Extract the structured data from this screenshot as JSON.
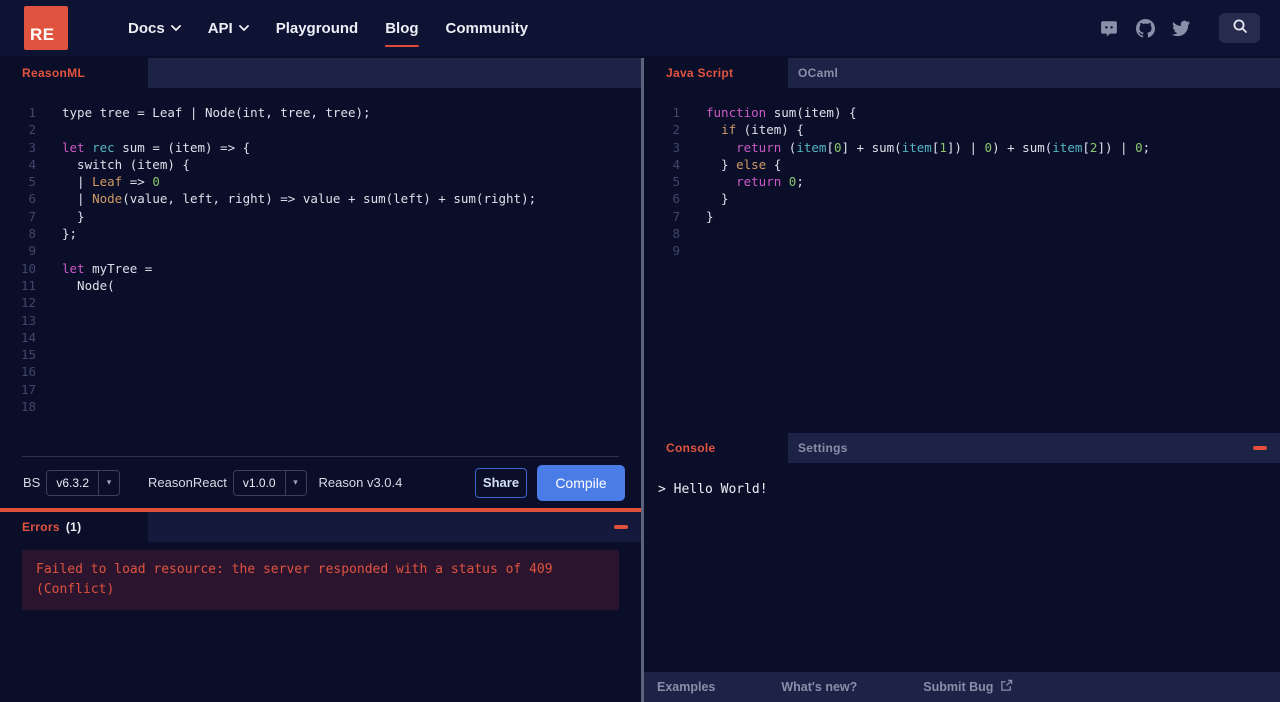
{
  "nav": {
    "logo_text": "RE",
    "links": [
      {
        "label": "Docs",
        "caret": true
      },
      {
        "label": "API",
        "caret": true
      },
      {
        "label": "Playground",
        "caret": false
      },
      {
        "label": "Blog",
        "caret": false,
        "active": true
      },
      {
        "label": "Community",
        "caret": false
      }
    ],
    "icons": [
      "discord-icon",
      "github-icon",
      "twitter-icon",
      "search-icon"
    ]
  },
  "left_editor": {
    "tab": "ReasonML",
    "total_lines": 18,
    "lines": [
      [
        {
          "t": "type tree = Leaf | Node(int, tree, tree);",
          "c": "plain"
        }
      ],
      [],
      [
        {
          "t": "let",
          "c": "kw"
        },
        {
          "t": " ",
          "c": "plain"
        },
        {
          "t": "rec",
          "c": "cyan"
        },
        {
          "t": " sum = (item) => {",
          "c": "plain"
        }
      ],
      [
        {
          "t": "  switch (item) {",
          "c": "plain"
        }
      ],
      [
        {
          "t": "  | ",
          "c": "plain"
        },
        {
          "t": "Leaf",
          "c": "orange"
        },
        {
          "t": " => ",
          "c": "plain"
        },
        {
          "t": "0",
          "c": "green"
        }
      ],
      [
        {
          "t": "  | ",
          "c": "plain"
        },
        {
          "t": "Node",
          "c": "orange"
        },
        {
          "t": "(value, left, right) => value + sum(left) + sum(right);",
          "c": "plain"
        }
      ],
      [
        {
          "t": "  }",
          "c": "plain"
        }
      ],
      [
        {
          "t": "};",
          "c": "plain"
        }
      ],
      [],
      [
        {
          "t": "let",
          "c": "kw"
        },
        {
          "t": " myTree =",
          "c": "plain"
        }
      ],
      [
        {
          "t": "  Node(",
          "c": "plain"
        }
      ]
    ]
  },
  "right_editor": {
    "tabs": [
      {
        "label": "Java Script",
        "active": true
      },
      {
        "label": "OCaml",
        "active": false
      }
    ],
    "total_lines": 9,
    "lines": [
      [
        {
          "t": "function",
          "c": "kw"
        },
        {
          "t": " sum(item) {",
          "c": "plain"
        }
      ],
      [
        {
          "t": "  ",
          "c": "plain"
        },
        {
          "t": "if",
          "c": "orange"
        },
        {
          "t": " (item) {",
          "c": "plain"
        }
      ],
      [
        {
          "t": "    ",
          "c": "plain"
        },
        {
          "t": "return",
          "c": "kw"
        },
        {
          "t": " (",
          "c": "plain"
        },
        {
          "t": "item",
          "c": "cyan"
        },
        {
          "t": "[",
          "c": "plain"
        },
        {
          "t": "0",
          "c": "green"
        },
        {
          "t": "] + sum(",
          "c": "plain"
        },
        {
          "t": "item",
          "c": "cyan"
        },
        {
          "t": "[",
          "c": "plain"
        },
        {
          "t": "1",
          "c": "green"
        },
        {
          "t": "]) | ",
          "c": "plain"
        },
        {
          "t": "0",
          "c": "green"
        },
        {
          "t": ") + sum(",
          "c": "plain"
        },
        {
          "t": "item",
          "c": "cyan"
        },
        {
          "t": "[",
          "c": "plain"
        },
        {
          "t": "2",
          "c": "green"
        },
        {
          "t": "]) | ",
          "c": "plain"
        },
        {
          "t": "0",
          "c": "green"
        },
        {
          "t": ";",
          "c": "plain"
        }
      ],
      [
        {
          "t": "  } ",
          "c": "plain"
        },
        {
          "t": "else",
          "c": "orange"
        },
        {
          "t": " {",
          "c": "plain"
        }
      ],
      [
        {
          "t": "    ",
          "c": "plain"
        },
        {
          "t": "return",
          "c": "kw"
        },
        {
          "t": " ",
          "c": "plain"
        },
        {
          "t": "0",
          "c": "green"
        },
        {
          "t": ";",
          "c": "plain"
        }
      ],
      [
        {
          "t": "  }",
          "c": "plain"
        }
      ],
      [
        {
          "t": "}",
          "c": "plain"
        }
      ]
    ]
  },
  "toolbar": {
    "bs_label": "BS",
    "bs_version": "v6.3.2",
    "reasonreact_label": "ReasonReact",
    "reasonreact_version": "v1.0.0",
    "reason_version": "Reason v3.0.4",
    "share_label": "Share",
    "compile_label": "Compile"
  },
  "errors": {
    "tab_label": "Errors",
    "count": "(1)",
    "message": "Failed to load resource: the server responded with a status of 409 (Conflict)"
  },
  "console": {
    "tabs": [
      {
        "label": "Console",
        "active": true
      },
      {
        "label": "Settings",
        "active": false
      }
    ],
    "output": "> Hello World!"
  },
  "footer": {
    "items": [
      "Examples",
      "What's new?",
      "Submit Bug"
    ]
  },
  "colors": {
    "accent_red": "#e0533f",
    "separator_orange": "#e04f38",
    "compile_blue": "#4a7ce8",
    "error_box_bg": "#2b152e",
    "strip_bg": "#1d2247",
    "page_bg": "#0a0e28"
  }
}
